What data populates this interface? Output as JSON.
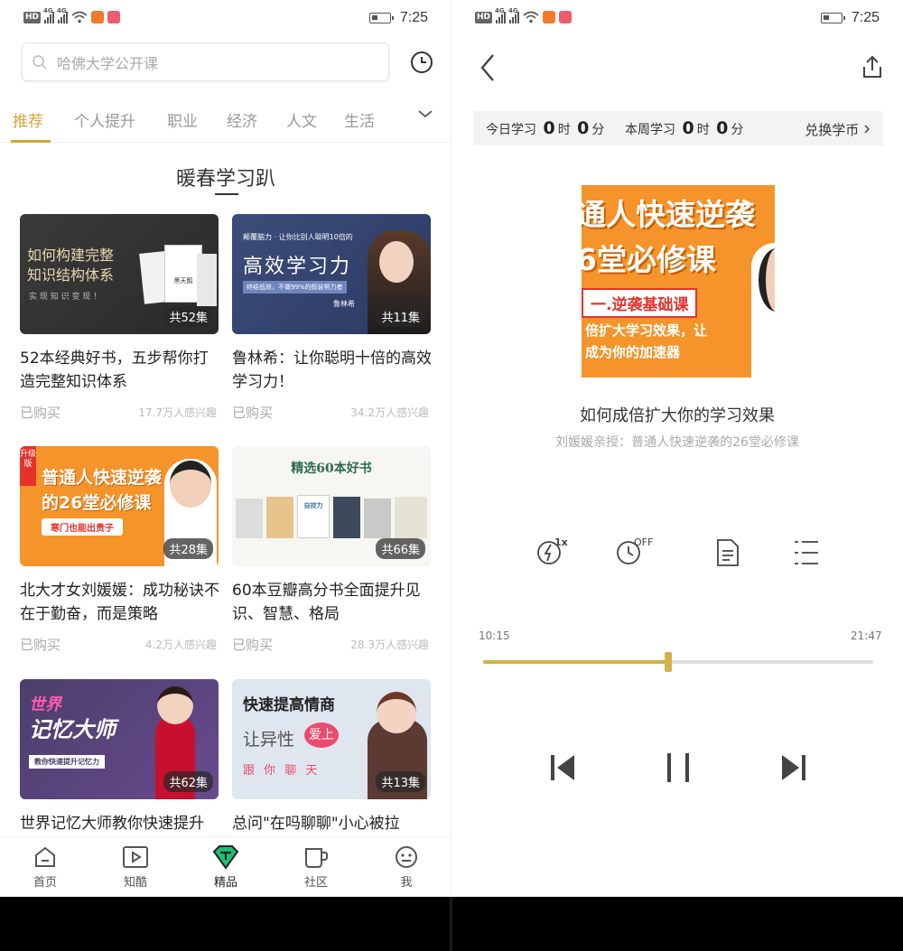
{
  "status": {
    "time": "7:25",
    "hd": "HD",
    "net1": "4G",
    "net2": "4G"
  },
  "left": {
    "search_placeholder": "哈佛大学公开课",
    "tabs": [
      {
        "label": "推荐",
        "active": true
      },
      {
        "label": "个人提升"
      },
      {
        "label": "职业"
      },
      {
        "label": "经济"
      },
      {
        "label": "人文"
      },
      {
        "label": "生活"
      }
    ],
    "section_title": "暖春学习趴",
    "cards": [
      {
        "title": "52本经典好书，五步帮你打造完整知识体系",
        "status": "已购买",
        "count": "17.7万人感兴趣",
        "episodes": "共52集",
        "thumb_lines": [
          "如何构建完整",
          "知识结构体系",
          "实 现 知 识 变 现 ！"
        ],
        "book_label": "黑天鹅"
      },
      {
        "title": "鲁林希：让你聪明十倍的高效学习力！",
        "status": "已购买",
        "count": "34.2万人感兴趣",
        "episodes": "共11集",
        "thumb_lines": [
          "颠覆脑力 · 让你比别人聪明10倍的",
          "高效学习力",
          "终结低效，不做99%的假装努力者",
          "鲁林希"
        ]
      },
      {
        "title": "北大才女刘媛媛：成功秘诀不在于勤奋，而是策略",
        "status": "已购买",
        "count": "4.2万人感兴趣",
        "episodes": "共28集",
        "thumb_lines": [
          "普通人快速逆袭",
          "的26堂必修课",
          "寒门也能出贵子"
        ],
        "tag": "升级版"
      },
      {
        "title": "60本豆瓣高分书全面提升见识、智慧、格局",
        "status": "已购买",
        "count": "28.3万人感兴趣",
        "episodes": "共66集",
        "thumb_lines": [
          "精选60本好书",
          "自控力"
        ]
      },
      {
        "title": "世界记忆大师教你快速提升",
        "status": "",
        "count": "",
        "episodes": "共62集",
        "thumb_lines": [
          "世界",
          "记忆大师",
          "教你快速提升记忆力"
        ]
      },
      {
        "title": "总问\"在吗聊聊\"小心被拉",
        "status": "",
        "count": "",
        "episodes": "共13集",
        "thumb_lines": [
          "快速提高情商",
          "让异性",
          "爱上",
          "跟 你 聊 天"
        ]
      }
    ],
    "nav": [
      {
        "label": "首页",
        "icon": "home-icon"
      },
      {
        "label": "知酷",
        "icon": "play-icon"
      },
      {
        "label": "精品",
        "icon": "gem-icon"
      },
      {
        "label": "社区",
        "icon": "cup-icon"
      },
      {
        "label": "我",
        "icon": "face-icon"
      }
    ]
  },
  "right": {
    "today_label": "今日学习",
    "today_h": "0",
    "today_h_unit": "时",
    "today_m": "0",
    "today_m_unit": "分",
    "week_label": "本周学习",
    "week_h": "0",
    "week_h_unit": "时",
    "week_m": "0",
    "week_m_unit": "分",
    "exchange": "兑换学币",
    "cover_lines": [
      "通人快速逆袭",
      "6堂必修课",
      "一.逆袭基础课",
      "倍扩大学习效果，让",
      "成为你的加速器"
    ],
    "title": "如何成倍扩大你的学习效果",
    "subtitle": "刘媛媛亲授：普通人快速逆袭的26堂必修课",
    "speed_label": "1x",
    "timer_label": "OFF",
    "time_current": "10:15",
    "time_total": "21:47",
    "progress": 0.47
  },
  "colors": {
    "accent": "#d4a43a",
    "progress": "#d4b04a"
  }
}
